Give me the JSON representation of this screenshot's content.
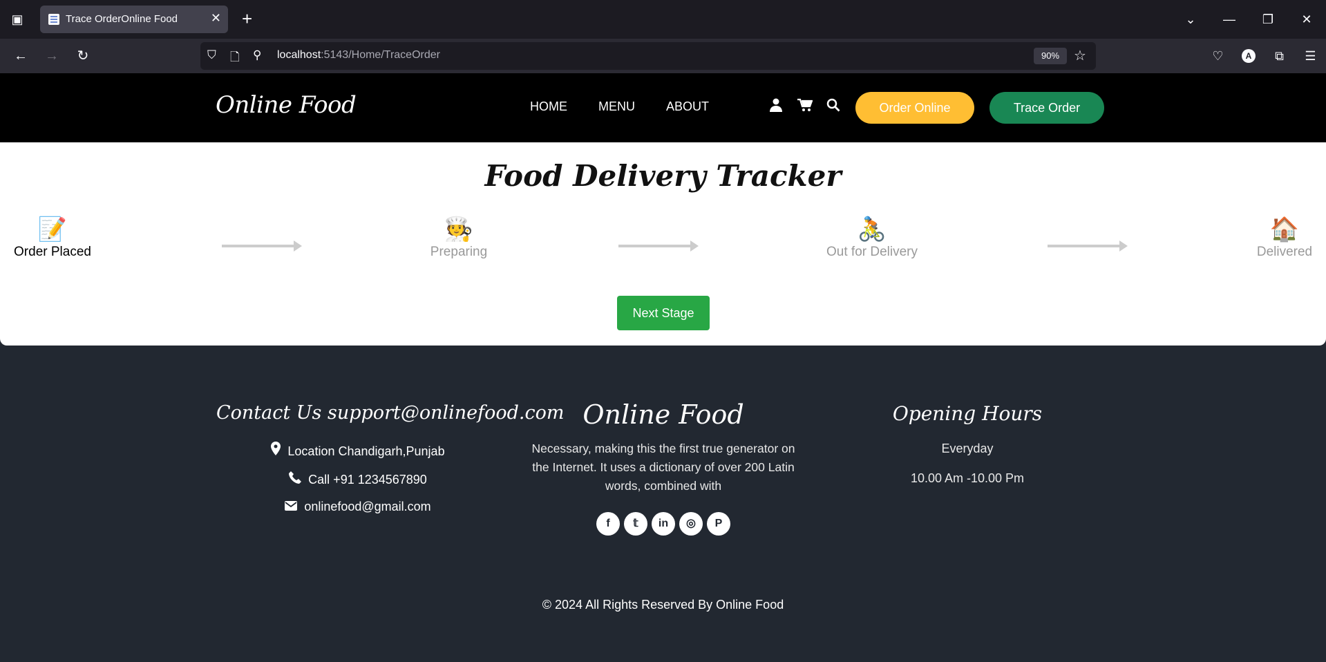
{
  "browser": {
    "tab_title": "Trace OrderOnline Food",
    "url_host": "localhost",
    "url_path": ":5143/Home/TraceOrder",
    "zoom": "90%"
  },
  "header": {
    "brand": "Online Food",
    "nav": [
      "HOME",
      "MENU",
      "ABOUT"
    ],
    "order_online": "Order Online",
    "trace_order": "Trace Order",
    "colors": {
      "order_online": "#ffbe33",
      "trace_order": "#198754"
    }
  },
  "tracker": {
    "title": "Food Delivery Tracker",
    "current_stage": 0,
    "stages": [
      {
        "label": "Order Placed",
        "icon": "memo-icon"
      },
      {
        "label": "Preparing",
        "icon": "chef-icon"
      },
      {
        "label": "Out for Delivery",
        "icon": "bicycle-icon"
      },
      {
        "label": "Delivered",
        "icon": "house-icon"
      }
    ],
    "next_button": "Next Stage",
    "colors": {
      "next_button": "#28a745"
    }
  },
  "footer": {
    "contact_title": "Contact Us support@onlinefood.com",
    "location": "Location Chandigarh,Punjab",
    "phone": "Call +91 1234567890",
    "email": "onlinefood@gmail.com",
    "brand": "Online Food",
    "about_text": "Necessary, making this the first true generator on the Internet. It uses a dictionary of over 200 Latin words, combined with",
    "socials": [
      "facebook-icon",
      "twitter-icon",
      "linkedin-icon",
      "instagram-icon",
      "pinterest-icon"
    ],
    "hours_title": "Opening Hours",
    "hours_day": "Everyday",
    "hours_time": "10.00 Am -10.00 Pm",
    "copyright": "© 2024 All Rights Reserved By Online Food"
  }
}
